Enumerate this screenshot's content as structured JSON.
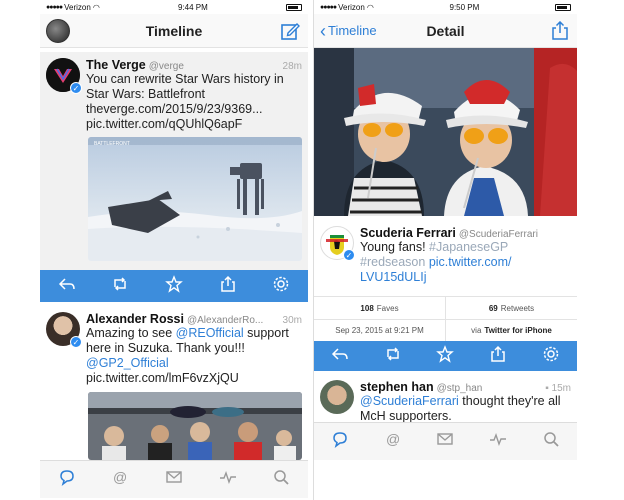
{
  "left": {
    "status": {
      "carrier": "Verizon",
      "time": "9:44 PM"
    },
    "nav_title": "Timeline",
    "tweets": [
      {
        "name": "The Verge",
        "handle": "@verge",
        "time": "28m",
        "text": "You can rewrite Star Wars history in Star Wars: Battlefront",
        "link1": "theverge.com/2015/9/23/9369...",
        "link2": "pic.twitter.com/qQUhlQ6apF"
      },
      {
        "name": "Alexander Rossi",
        "handle": "@AlexanderRo...",
        "time": "30m",
        "text_mention": "@REOfficial",
        "text_prefix": "Amazing to see ",
        "text_suffix": "support here in Suzuka. Thank you!!! ",
        "text_mention2": "@GP2_Official",
        "link": "pic.twitter.com/lmF6vzXjQU"
      }
    ]
  },
  "right": {
    "status": {
      "carrier": "Verizon",
      "time": "9:50 PM"
    },
    "back_label": "Timeline",
    "nav_title": "Detail",
    "tweet": {
      "name": "Scuderia Ferrari",
      "handle": "@ScuderiaFerrari",
      "text_prefix": "Young fans! ",
      "hashtag1": "#JapaneseGP",
      "hashtag2": "#redseason",
      "link1": "pic.twitter.com/",
      "link2": "LVU15dULIj"
    },
    "stats": {
      "faves_count": "108",
      "faves_label": "Faves",
      "retweets_count": "69",
      "retweets_label": "Retweets",
      "date": "Sep 23, 2015 at 9:21 PM",
      "via_prefix": "via",
      "via_client": "Twitter for iPhone"
    },
    "reply": {
      "name": "stephen han",
      "handle": "@stp_han",
      "time": "15m",
      "mention": "@ScuderiaFerrari",
      "text": " thought they're all McH supporters."
    }
  },
  "colors": {
    "accent": "#3d8ddc",
    "link": "#2e7fd6"
  },
  "icons": [
    "compose-icon",
    "reply-icon",
    "retweet-icon",
    "favorite-icon",
    "share-icon",
    "settings-icon",
    "timeline-tab-icon",
    "mentions-tab-icon",
    "messages-tab-icon",
    "activity-tab-icon",
    "search-tab-icon"
  ]
}
